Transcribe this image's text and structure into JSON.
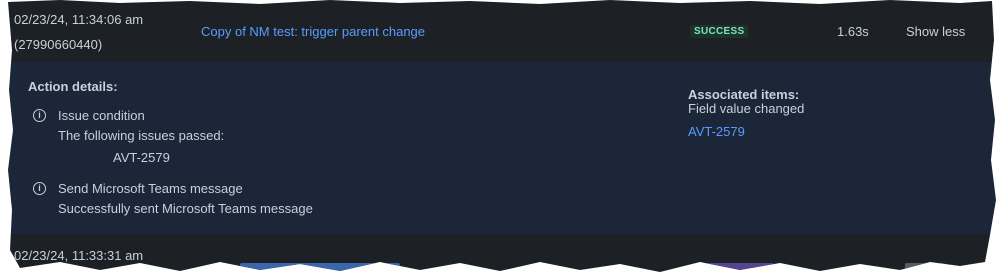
{
  "row1": {
    "timestamp": "02/23/24, 11:34:06 am",
    "id": "(27990660440)",
    "rule_name": "Copy of NM test: trigger parent change",
    "status": "SUCCESS",
    "duration": "1.63s",
    "toggle_label": "Show less"
  },
  "details": {
    "heading": "Action details:",
    "actions": [
      {
        "icon": "info-icon",
        "title": "Issue condition",
        "subtitle": "The following issues passed:",
        "issue": "AVT-2579"
      },
      {
        "icon": "info-icon",
        "title": "Send Microsoft Teams message",
        "subtitle": "Successfully sent Microsoft Teams message"
      }
    ],
    "associated": {
      "heading": "Associated items:",
      "type": "Field value changed",
      "issue_link": "AVT-2579"
    }
  },
  "row2": {
    "timestamp": "02/23/24, 11:33:31 am"
  },
  "colors": {
    "row_bg": "#1d2125",
    "details_bg": "#1b2638",
    "text": "#c7d1db",
    "link": "#579dff",
    "success_bg": "#1c3329",
    "success_text": "#7ee2b8"
  }
}
